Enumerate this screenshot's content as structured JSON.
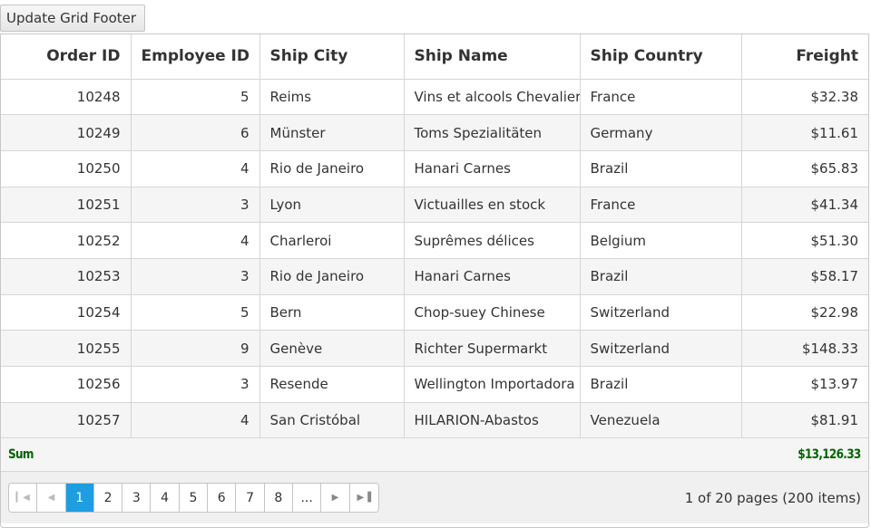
{
  "toolbar": {
    "update_button_label": "Update Grid Footer"
  },
  "grid": {
    "columns": [
      "Order ID",
      "Employee ID",
      "Ship City",
      "Ship Name",
      "Ship Country",
      "Freight"
    ],
    "rows": [
      [
        "10248",
        "5",
        "Reims",
        "Vins et alcools Chevalier",
        "France",
        "$32.38"
      ],
      [
        "10249",
        "6",
        "Münster",
        "Toms Spezialitäten",
        "Germany",
        "$11.61"
      ],
      [
        "10250",
        "4",
        "Rio de Janeiro",
        "Hanari Carnes",
        "Brazil",
        "$65.83"
      ],
      [
        "10251",
        "3",
        "Lyon",
        "Victuailles en stock",
        "France",
        "$41.34"
      ],
      [
        "10252",
        "4",
        "Charleroi",
        "Suprêmes délices",
        "Belgium",
        "$51.30"
      ],
      [
        "10253",
        "3",
        "Rio de Janeiro",
        "Hanari Carnes",
        "Brazil",
        "$58.17"
      ],
      [
        "10254",
        "5",
        "Bern",
        "Chop-suey Chinese",
        "Switzerland",
        "$22.98"
      ],
      [
        "10255",
        "9",
        "Genève",
        "Richter Supermarkt",
        "Switzerland",
        "$148.33"
      ],
      [
        "10256",
        "3",
        "Resende",
        "Wellington Importadora",
        "Brazil",
        "$13.97"
      ],
      [
        "10257",
        "4",
        "San Cristóbal",
        "HILARION-Abastos",
        "Venezuela",
        "$81.91"
      ]
    ],
    "footer": {
      "sum_label": "Sum",
      "sum_value": "$13,126.33",
      "sum_color": "#006400"
    }
  },
  "pager": {
    "first_icon": "first-page-icon",
    "prev_icon": "previous-page-icon",
    "next_icon": "next-page-icon",
    "last_icon": "last-page-icon",
    "pages": [
      "1",
      "2",
      "3",
      "4",
      "5",
      "6",
      "7",
      "8",
      "..."
    ],
    "current_page": "1",
    "info": "1 of 20 pages (200 items)",
    "accent_color": "#1e9de0"
  }
}
